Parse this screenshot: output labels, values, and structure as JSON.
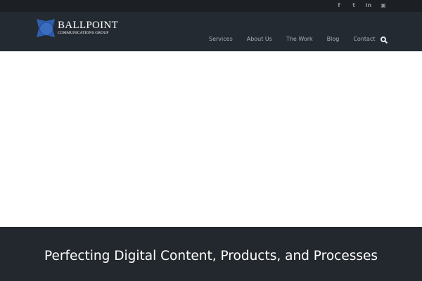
{
  "social": [
    {
      "icon": "facebook-icon",
      "glyph": "f"
    },
    {
      "icon": "twitter-icon",
      "glyph": "t"
    },
    {
      "icon": "linkedin-icon",
      "glyph": "in"
    },
    {
      "icon": "instagram-icon",
      "glyph": "▣"
    }
  ],
  "logo": {
    "name": "BALLPOINT",
    "tagline": "COMMUNICATIONS GROUP"
  },
  "nav": [
    "Services",
    "About Us",
    "The Work",
    "Blog",
    "Contact"
  ],
  "band": {
    "title": "Perfecting Digital Content, Products, and Processes"
  }
}
